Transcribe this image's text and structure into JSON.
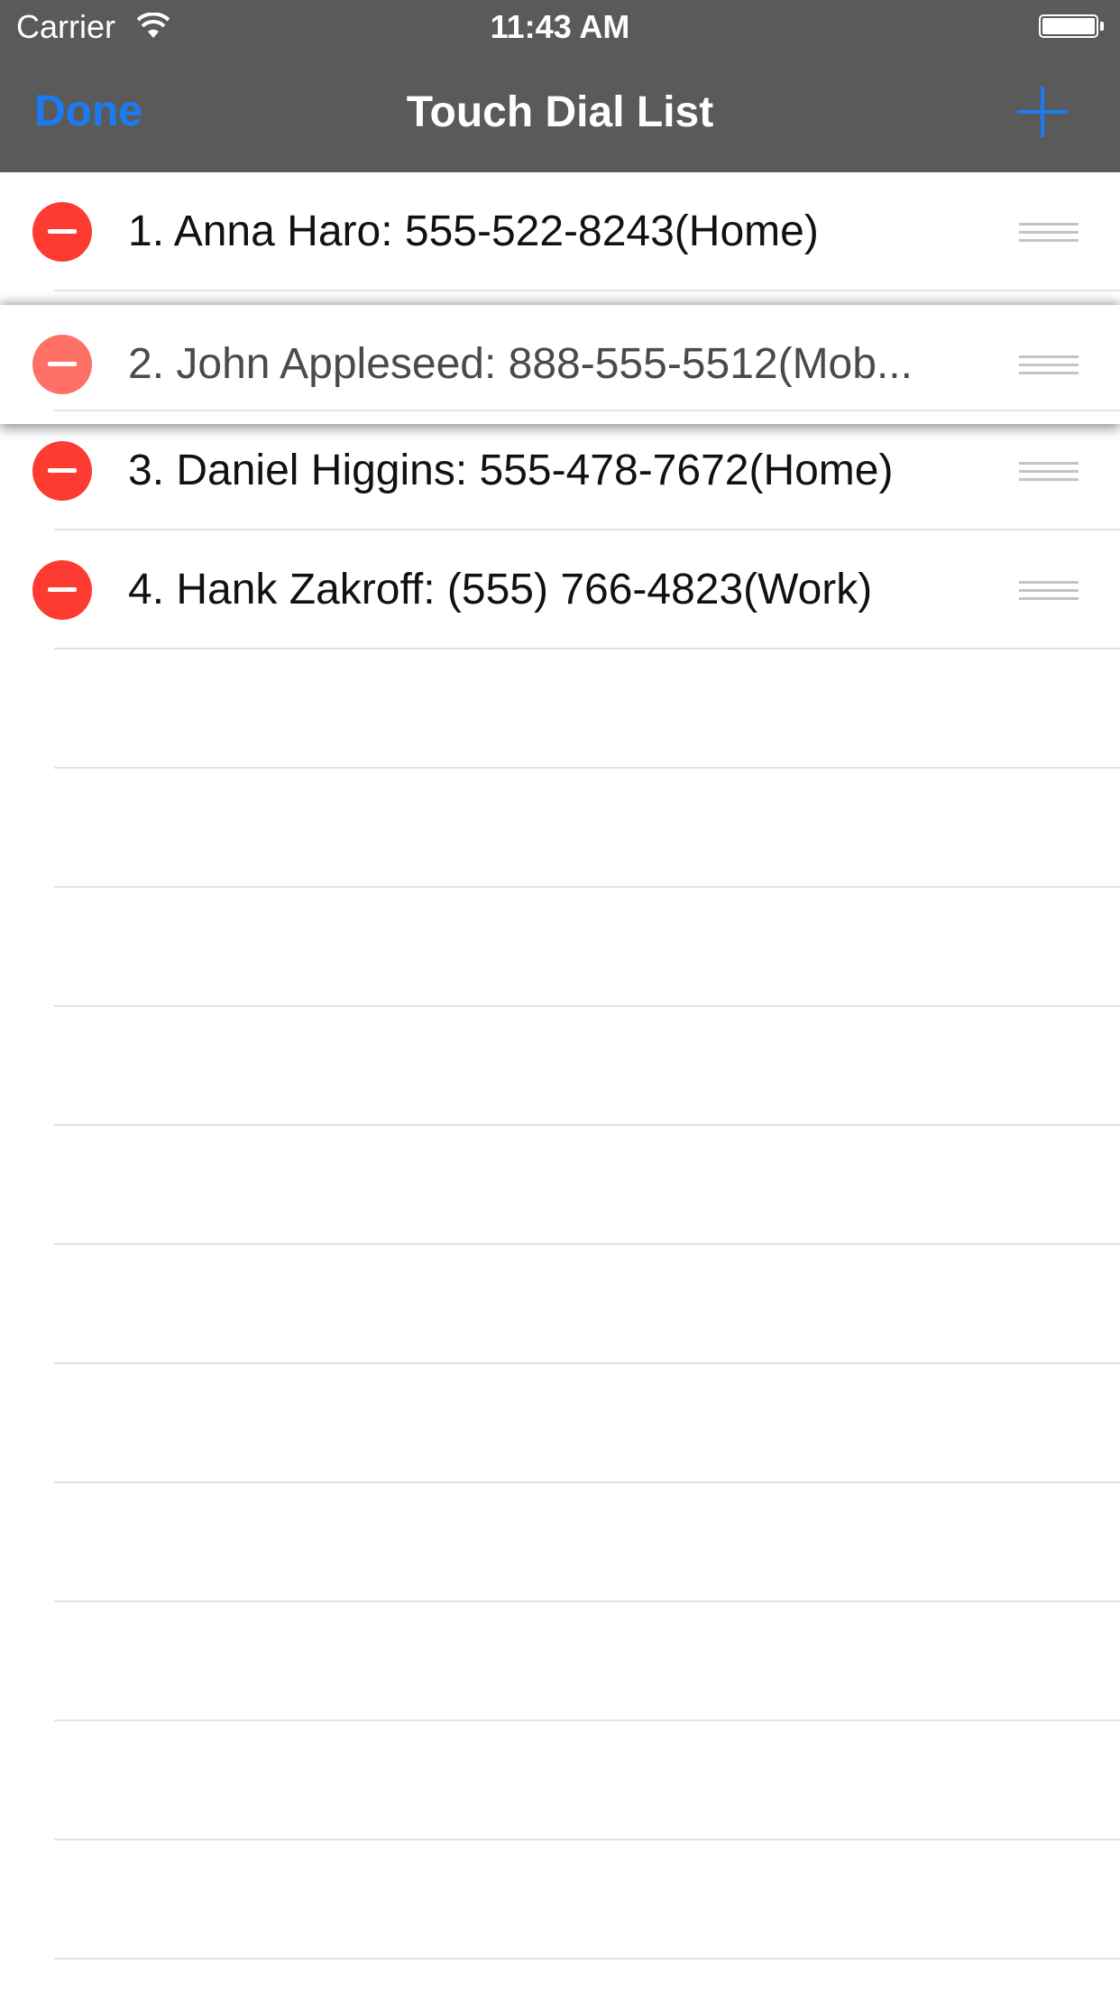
{
  "status_bar": {
    "carrier": "Carrier",
    "time": "11:43 AM"
  },
  "nav": {
    "done_label": "Done",
    "title": "Touch Dial List",
    "add_icon": "plus-icon",
    "accent_color": "#1a7cf5"
  },
  "contacts": [
    {
      "label": "1. Anna Haro: 555-522-8243(Home)"
    },
    {
      "label": "2. John Appleseed: 888-555-5512(Mob..."
    },
    {
      "label": "3. Daniel Higgins: 555-478-7672(Home)"
    },
    {
      "label": "4. Hank Zakroff: (555) 766-4823(Work)"
    }
  ],
  "colors": {
    "delete_red": "#fd3b30",
    "header_gray": "#5a5a5a"
  }
}
